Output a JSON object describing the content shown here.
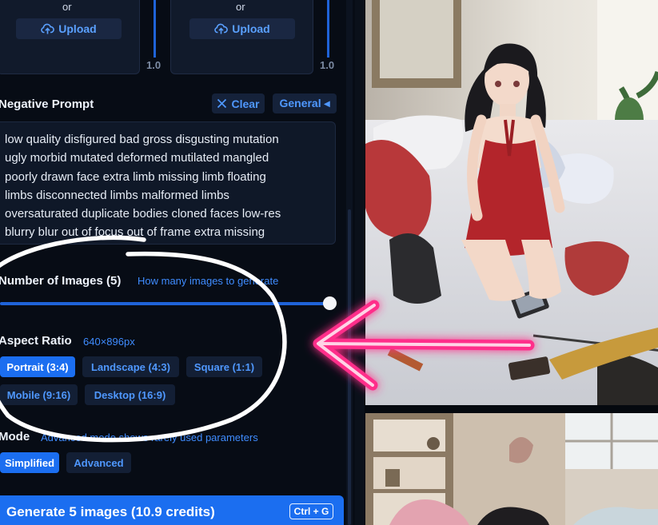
{
  "upload": {
    "or_text": "or",
    "button_label": "Upload",
    "weight_value": "1.0"
  },
  "negative_prompt": {
    "label": "Negative Prompt",
    "clear_label": "Clear",
    "general_label": "General ◂",
    "lines": [
      "low quality disfigured bad gross disgusting mutation",
      "ugly morbid mutated deformed mutilated mangled",
      "poorly drawn face extra limb missing limb floating",
      "limbs disconnected limbs malformed limbs",
      "oversaturated duplicate bodies cloned faces low-res",
      "blurry blur out of focus out of frame extra missing"
    ]
  },
  "num_images": {
    "label": "Number of Images (5)",
    "hint": "How many images to generate",
    "value_fraction": 1.0
  },
  "aspect": {
    "label": "Aspect Ratio",
    "size": "640×896px",
    "options": [
      "Portrait (3:4)",
      "Landscape (4:3)",
      "Square (1:1)",
      "Mobile (9:16)",
      "Desktop (16:9)"
    ],
    "selected": "Portrait (3:4)"
  },
  "mode": {
    "label": "Mode",
    "hint": "Advanced mode shows rarely used parameters",
    "options": [
      "Simplified",
      "Advanced"
    ],
    "selected": "Simplified"
  },
  "generate": {
    "label": "Generate 5 images (10.9 credits)",
    "shortcut": "Ctrl + G"
  },
  "colors": {
    "accent": "#1b6ef0",
    "link": "#3f8cff",
    "panel_bg": "#070c15",
    "annotation_arrow": "#ff2d8a"
  },
  "icons": [
    "cloud-upload-icon",
    "close-icon",
    "caret-left-icon"
  ]
}
